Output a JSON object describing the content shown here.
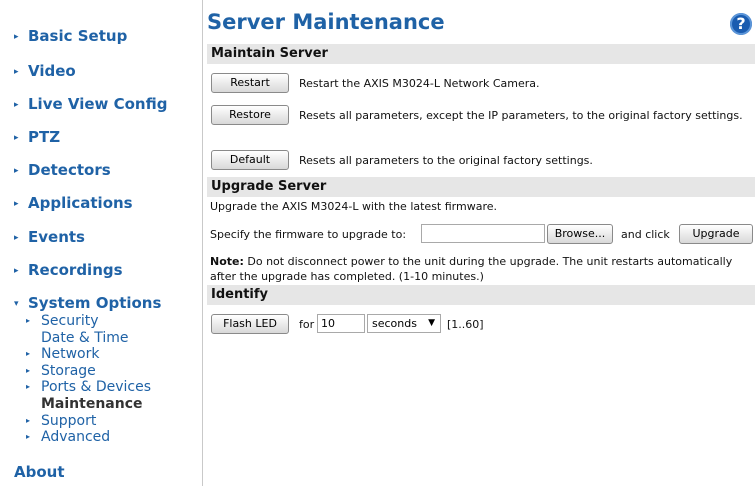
{
  "sidebar": {
    "items": [
      {
        "label": "Basic Setup"
      },
      {
        "label": "Video"
      },
      {
        "label": "Live View Config"
      },
      {
        "label": "PTZ"
      },
      {
        "label": "Detectors"
      },
      {
        "label": "Applications"
      },
      {
        "label": "Events"
      },
      {
        "label": "Recordings"
      },
      {
        "label": "System Options"
      }
    ],
    "system_options_sub": [
      {
        "label": "Security"
      },
      {
        "label": "Date & Time"
      },
      {
        "label": "Network"
      },
      {
        "label": "Storage"
      },
      {
        "label": "Ports & Devices"
      },
      {
        "label": "Maintenance"
      },
      {
        "label": "Support"
      },
      {
        "label": "Advanced"
      }
    ],
    "about": "About",
    "collapsed_marker": "▸",
    "expanded_marker": "▾"
  },
  "page": {
    "title": "Server Maintenance",
    "help_icon": "?"
  },
  "maintain": {
    "header": "Maintain Server",
    "restart_button": "Restart",
    "restart_desc": "Restart the AXIS M3024-L Network Camera.",
    "restore_button": "Restore",
    "restore_desc": "Resets all parameters, except the IP parameters, to the original factory settings.",
    "default_button": "Default",
    "default_desc": "Resets all parameters to the original factory settings."
  },
  "upgrade": {
    "header": "Upgrade Server",
    "intro": "Upgrade the AXIS M3024-L with the latest firmware.",
    "specify_label": "Specify the firmware to upgrade to:",
    "file_value": "",
    "browse_button": "Browse...",
    "and_click": "and click",
    "upgrade_button": "Upgrade",
    "note_label": "Note:",
    "note_text": "Do not disconnect power to the unit during the upgrade. The unit restarts automatically after the upgrade has completed. (1-10 minutes.)"
  },
  "identify": {
    "header": "Identify",
    "flash_button": "Flash LED",
    "for_label": "for",
    "duration_value": "10",
    "unit_selected": "seconds",
    "range_hint": "[1..60]"
  },
  "colors": {
    "link_blue": "#1f62a6",
    "header_gray": "#e6e6e6",
    "help_blue": "#1a5cb0"
  }
}
